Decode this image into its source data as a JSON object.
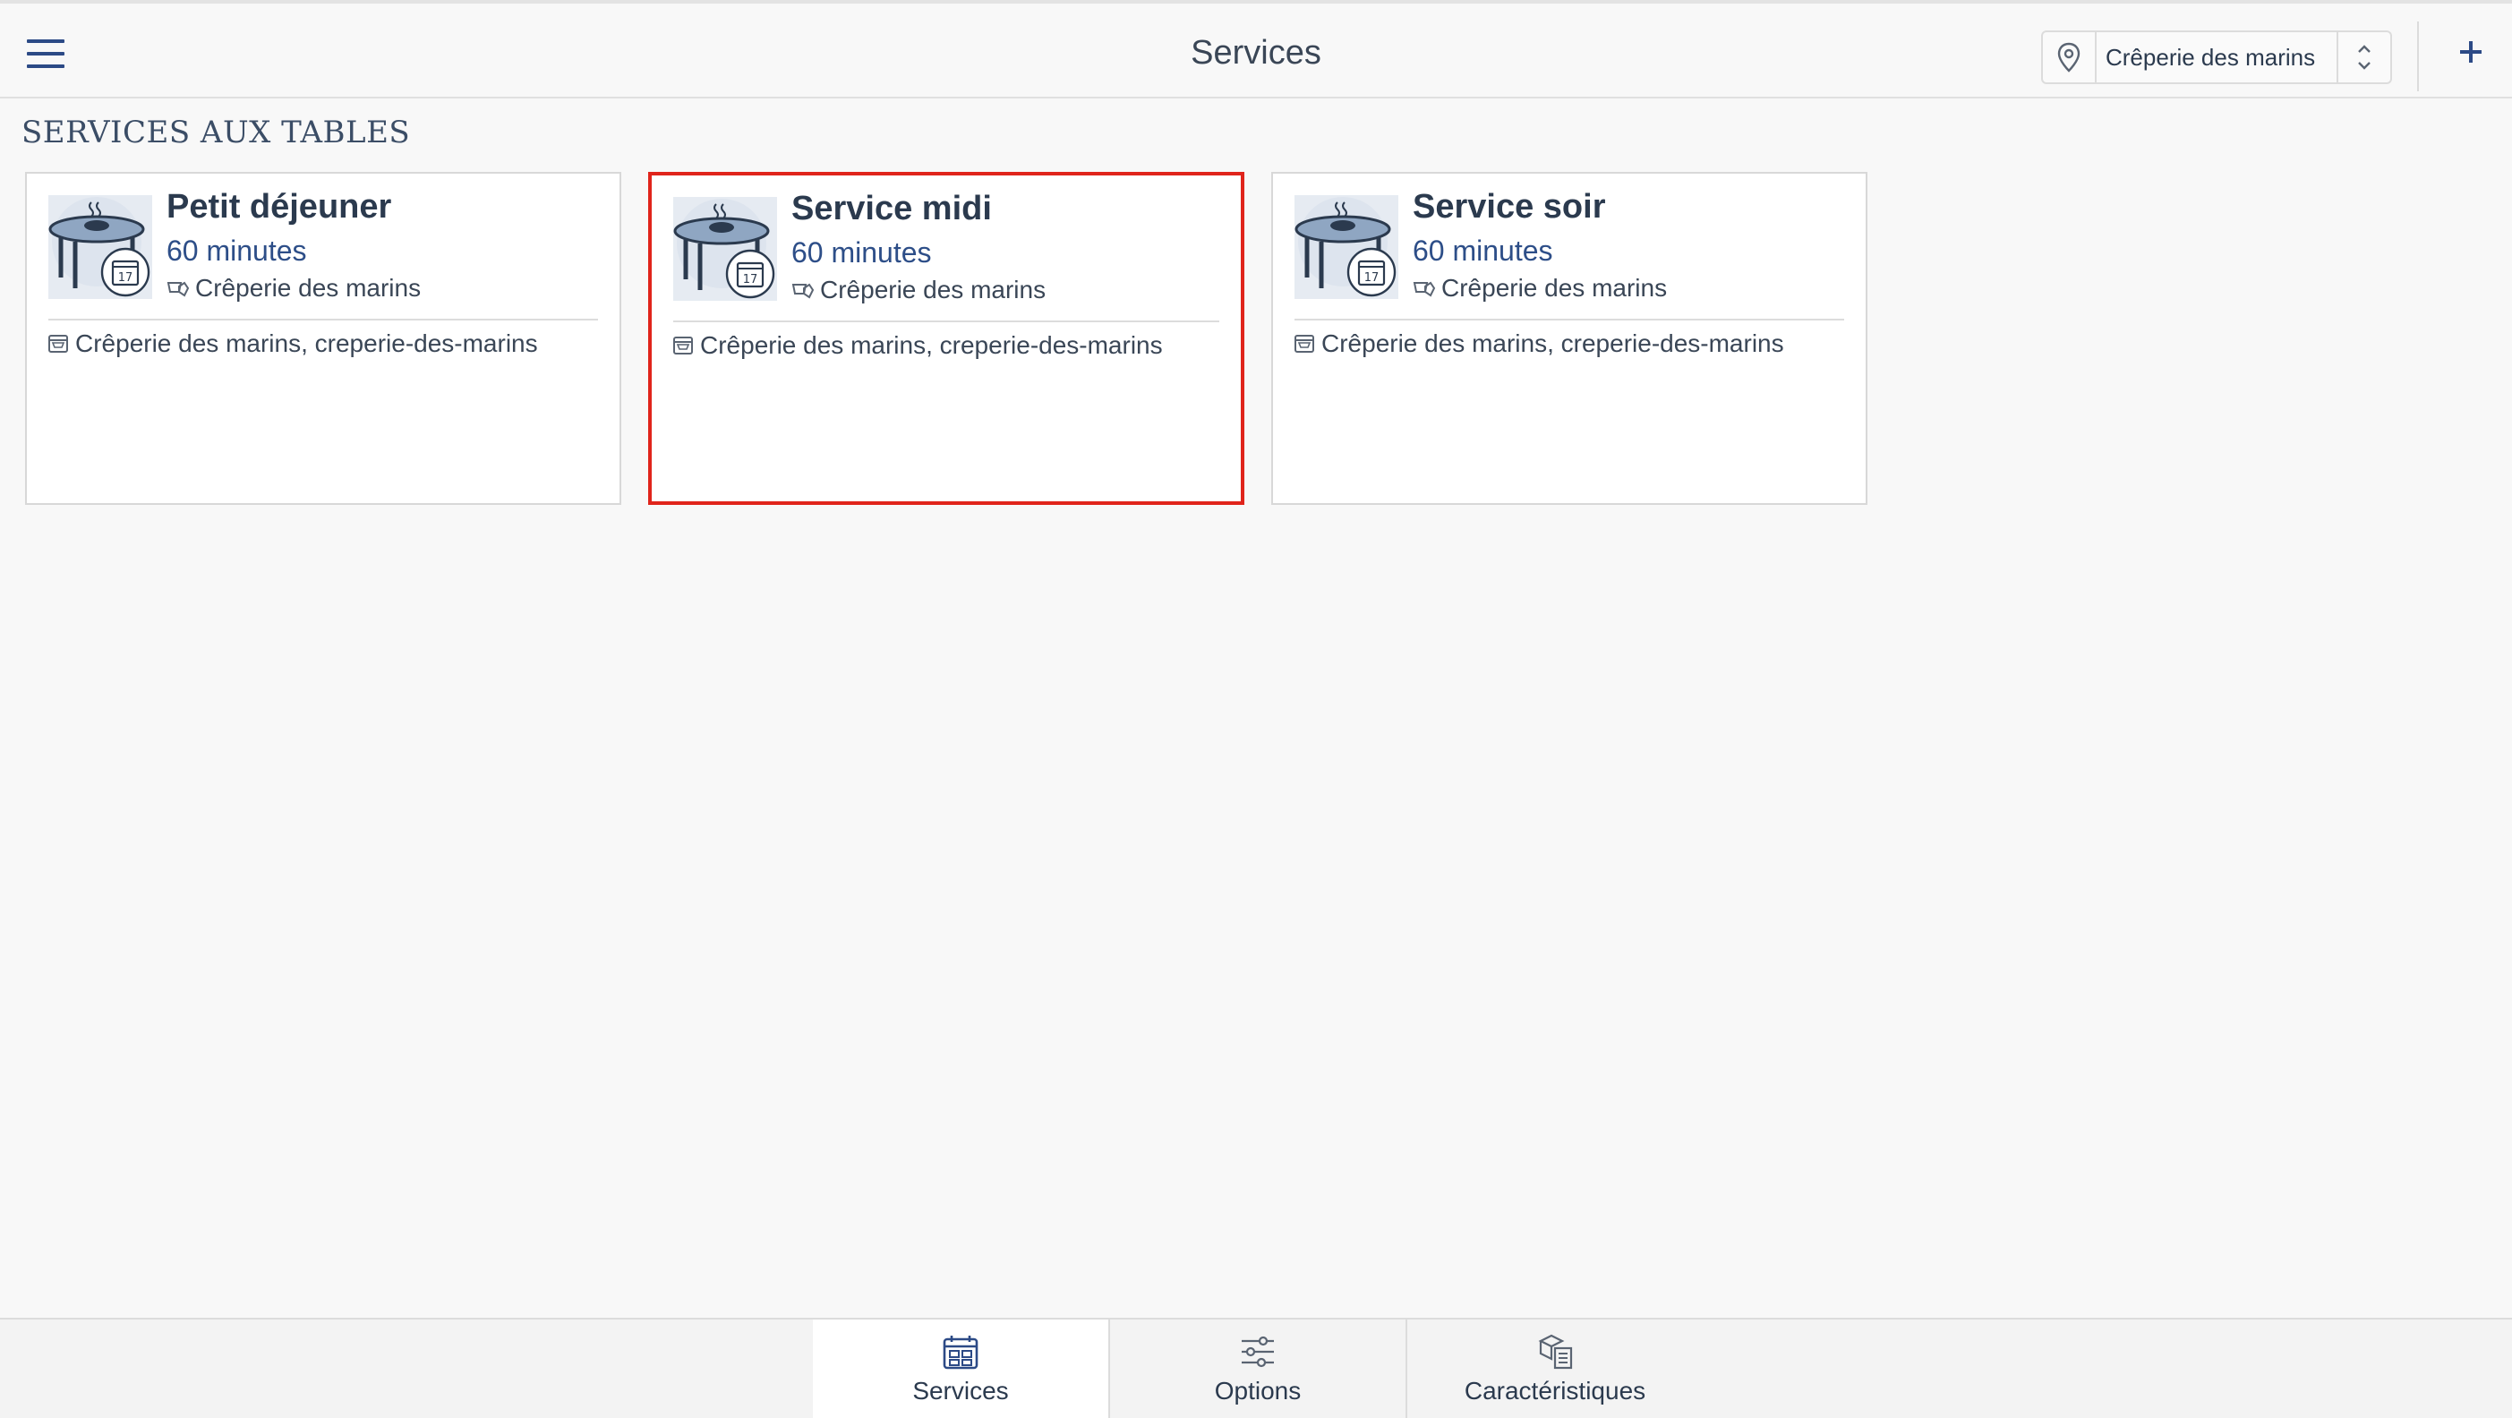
{
  "header": {
    "title": "Services",
    "location_select": {
      "value": "Crêperie des marins",
      "icon": "map-pin-icon"
    },
    "add_icon": "plus-icon",
    "menu_icon": "hamburger-icon"
  },
  "section": {
    "title": "SERVICES AUX TABLES"
  },
  "services": [
    {
      "title": "Petit déjeuner",
      "duration": "60 minutes",
      "place": "Crêperie des marins",
      "shop": "Crêperie des marins, creperie-des-marins",
      "selected": false
    },
    {
      "title": "Service midi",
      "duration": "60 minutes",
      "place": "Crêperie des marins",
      "shop": "Crêperie des marins, creperie-des-marins",
      "selected": true
    },
    {
      "title": "Service soir",
      "duration": "60 minutes",
      "place": "Crêperie des marins",
      "shop": "Crêperie des marins, creperie-des-marins",
      "selected": false
    }
  ],
  "tabs": [
    {
      "label": "Services",
      "icon": "calendar-grid-icon",
      "active": true
    },
    {
      "label": "Options",
      "icon": "sliders-icon",
      "active": false
    },
    {
      "label": "Caractéristiques",
      "icon": "features-icon",
      "active": false
    }
  ],
  "colors": {
    "accent": "#2c4a86",
    "selected_border": "#e0241b",
    "background": "#f8f8f8"
  }
}
